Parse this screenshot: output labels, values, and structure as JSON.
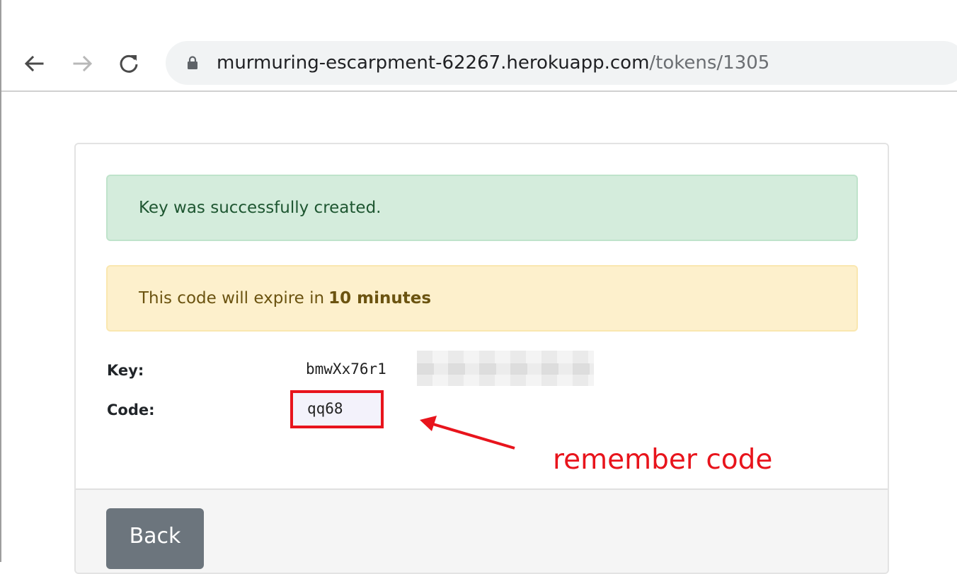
{
  "browser": {
    "url_host": "murmuring-escarpment-62267.herokuapp.com",
    "url_path": "/tokens/1305",
    "back_icon": "arrow-left-icon",
    "forward_icon": "arrow-right-icon",
    "reload_icon": "reload-icon",
    "lock_icon": "lock-icon"
  },
  "alerts": {
    "success": "Key was successfully created.",
    "warning_prefix": "This code will expire in",
    "warning_emphasis": "10 minutes"
  },
  "details": {
    "key_label": "Key:",
    "key_value": "bmwXx76r1",
    "code_label": "Code:",
    "code_value": "qq68"
  },
  "annotation": {
    "text": "remember code",
    "color": "#e8141c"
  },
  "footer": {
    "back_label": "Back"
  },
  "colors": {
    "success_bg": "#d4ecdc",
    "warning_bg": "#fdf0cc",
    "button_bg": "#6c757d"
  }
}
